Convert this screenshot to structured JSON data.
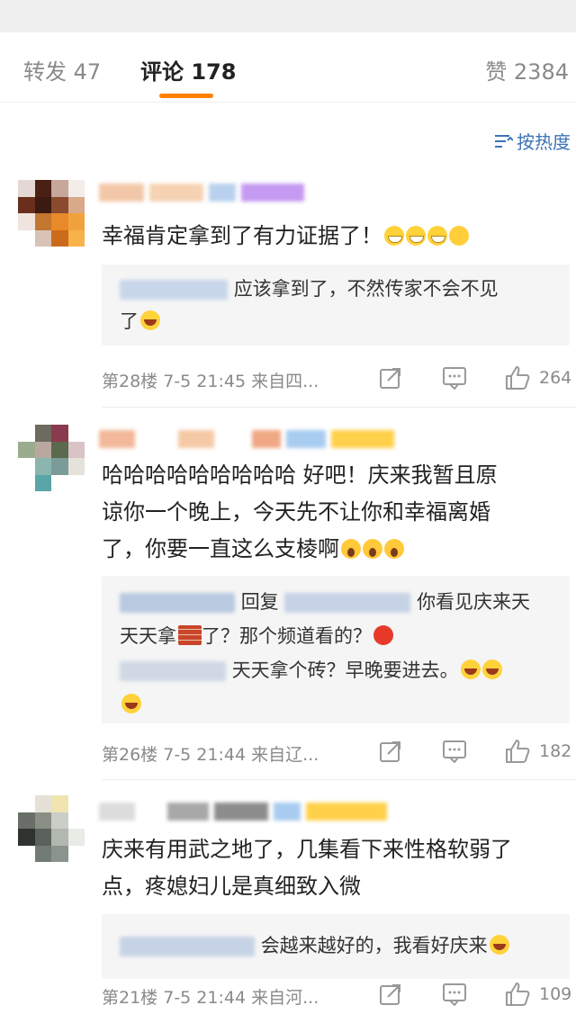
{
  "tabs": {
    "repost_label": "转发 47",
    "comment_label": "评论 178",
    "like_label": "赞 2384"
  },
  "sort": {
    "label": "按热度",
    "icon": "sort-lines-icon"
  },
  "comments": [
    {
      "text": "幸福肯定拿到了有力证据了！",
      "emojis": [
        "grin",
        "grin",
        "grin",
        "think"
      ],
      "reply_lines": [
        "应该拿到了，不然传家不会不见",
        "了"
      ],
      "floor": "第28楼",
      "time": "7-5 21:45",
      "source": "来自四...",
      "likes": "264"
    },
    {
      "text_lines": [
        "哈哈哈哈哈哈哈哈哈 好吧！庆来我暂且原",
        "谅你一个晚上，今天先不让你和幸福离婚",
        "了，你要一直这么支棱啊"
      ],
      "reply_lines": [
        "回复",
        "你看见庆来天",
        "天天拿",
        "了？那个频道看的？",
        "天天拿个砖？早晚要进去。"
      ],
      "floor": "第26楼",
      "time": "7-5 21:44",
      "source": "来自辽...",
      "likes": "182"
    },
    {
      "text_lines": [
        "庆来有用武之地了，几集看下来性格软弱了",
        "点，疼媳妇儿是真细致入微"
      ],
      "reply_lines": [
        "会越来越好的，我看好庆来"
      ],
      "floor": "第21楼",
      "time": "7-5 21:44",
      "source": "来自河...",
      "likes": "109"
    }
  ],
  "colors": {
    "accent": "#ff8200",
    "link": "#3e73b7",
    "muted": "#8a8a8a"
  }
}
